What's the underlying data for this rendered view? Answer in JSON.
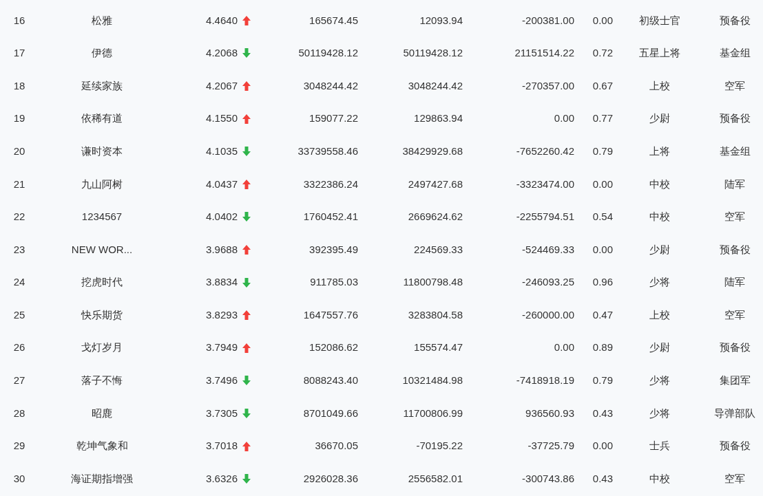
{
  "rows": [
    {
      "rank": "16",
      "name": "松雅",
      "score": "4.4640",
      "rising": true,
      "col4": "165674.45",
      "col5": "12093.94",
      "col6": "-200381.00",
      "col7": "0.00",
      "title": "初级士官",
      "group": "预备役"
    },
    {
      "rank": "17",
      "name": "伊德",
      "score": "4.2068",
      "rising": false,
      "col4": "50119428.12",
      "col5": "50119428.12",
      "col6": "21151514.22",
      "col7": "0.72",
      "title": "五星上将",
      "group": "基金组"
    },
    {
      "rank": "18",
      "name": "延续家族",
      "score": "4.2067",
      "rising": true,
      "col4": "3048244.42",
      "col5": "3048244.42",
      "col6": "-270357.00",
      "col7": "0.67",
      "title": "上校",
      "group": "空军"
    },
    {
      "rank": "19",
      "name": "依稀有道",
      "score": "4.1550",
      "rising": true,
      "col4": "159077.22",
      "col5": "129863.94",
      "col6": "0.00",
      "col7": "0.77",
      "title": "少尉",
      "group": "预备役"
    },
    {
      "rank": "20",
      "name": "谦时资本",
      "score": "4.1035",
      "rising": false,
      "col4": "33739558.46",
      "col5": "38429929.68",
      "col6": "-7652260.42",
      "col7": "0.79",
      "title": "上将",
      "group": "基金组"
    },
    {
      "rank": "21",
      "name": "九山阿树",
      "score": "4.0437",
      "rising": true,
      "col4": "3322386.24",
      "col5": "2497427.68",
      "col6": "-3323474.00",
      "col7": "0.00",
      "title": "中校",
      "group": "陆军"
    },
    {
      "rank": "22",
      "name": "1234567",
      "score": "4.0402",
      "rising": false,
      "col4": "1760452.41",
      "col5": "2669624.62",
      "col6": "-2255794.51",
      "col7": "0.54",
      "title": "中校",
      "group": "空军"
    },
    {
      "rank": "23",
      "name": "NEW WOR...",
      "score": "3.9688",
      "rising": true,
      "col4": "392395.49",
      "col5": "224569.33",
      "col6": "-524469.33",
      "col7": "0.00",
      "title": "少尉",
      "group": "预备役"
    },
    {
      "rank": "24",
      "name": "挖虎时代",
      "score": "3.8834",
      "rising": false,
      "col4": "911785.03",
      "col5": "11800798.48",
      "col6": "-246093.25",
      "col7": "0.96",
      "title": "少将",
      "group": "陆军"
    },
    {
      "rank": "25",
      "name": "快乐期货",
      "score": "3.8293",
      "rising": true,
      "col4": "1647557.76",
      "col5": "3283804.58",
      "col6": "-260000.00",
      "col7": "0.47",
      "title": "上校",
      "group": "空军"
    },
    {
      "rank": "26",
      "name": "戈灯岁月",
      "score": "3.7949",
      "rising": true,
      "col4": "152086.62",
      "col5": "155574.47",
      "col6": "0.00",
      "col7": "0.89",
      "title": "少尉",
      "group": "预备役"
    },
    {
      "rank": "27",
      "name": "落子不悔",
      "score": "3.7496",
      "rising": false,
      "col4": "8088243.40",
      "col5": "10321484.98",
      "col6": "-7418918.19",
      "col7": "0.79",
      "title": "少将",
      "group": "集团军"
    },
    {
      "rank": "28",
      "name": "昭鹿",
      "score": "3.7305",
      "rising": false,
      "col4": "8701049.66",
      "col5": "11700806.99",
      "col6": "936560.93",
      "col7": "0.43",
      "title": "少将",
      "group": "导弹部队"
    },
    {
      "rank": "29",
      "name": "乾坤气象和",
      "score": "3.7018",
      "rising": true,
      "col4": "36670.05",
      "col5": "-70195.22",
      "col6": "-37725.79",
      "col7": "0.00",
      "title": "士兵",
      "group": "预备役"
    },
    {
      "rank": "30",
      "name": "海证期指增强",
      "score": "3.6326",
      "rising": false,
      "col4": "2926028.36",
      "col5": "2556582.01",
      "col6": "-300743.86",
      "col7": "0.43",
      "title": "中校",
      "group": "空军"
    }
  ]
}
